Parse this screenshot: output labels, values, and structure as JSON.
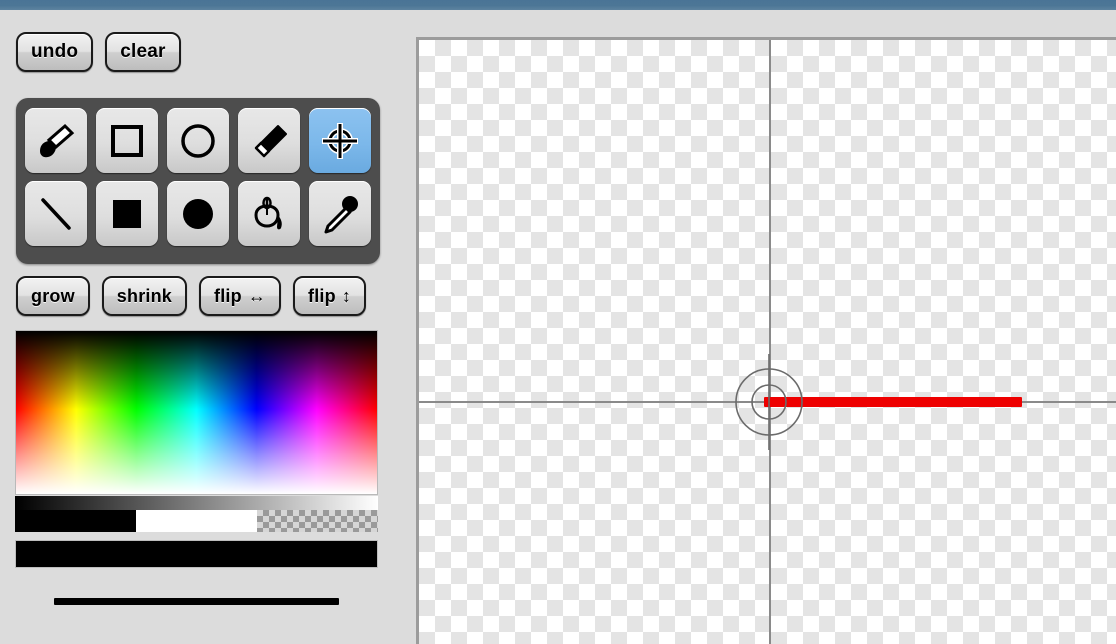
{
  "app": {
    "title": "Paint Canvas Editor",
    "accent_color": "#4a7496",
    "panel_background": "#dcdcdc",
    "palette_background": "#4d4d4d"
  },
  "history_buttons": [
    {
      "label": "undo",
      "name": "undo-button"
    },
    {
      "label": "clear",
      "name": "clear-button"
    }
  ],
  "tools": {
    "selected": "move-target",
    "selected_color": "#7cb8ea",
    "row1": [
      {
        "label": "brush",
        "icon": "brush-icon",
        "selected": false
      },
      {
        "label": "rectangle outline",
        "icon": "square-outline-icon",
        "selected": false
      },
      {
        "label": "ellipse outline",
        "icon": "circle-outline-icon",
        "selected": false
      },
      {
        "label": "eraser",
        "icon": "eraser-icon",
        "selected": false
      },
      {
        "label": "move target",
        "icon": "crosshair-target-icon",
        "selected": true
      }
    ],
    "row2": [
      {
        "label": "line",
        "icon": "line-icon",
        "selected": false
      },
      {
        "label": "filled rectangle",
        "icon": "square-filled-icon",
        "selected": false
      },
      {
        "label": "filled ellipse",
        "icon": "circle-filled-icon",
        "selected": false
      },
      {
        "label": "paint bucket",
        "icon": "paint-bucket-icon",
        "selected": false
      },
      {
        "label": "eyedropper",
        "icon": "eyedropper-icon",
        "selected": false
      }
    ]
  },
  "transform_buttons": [
    {
      "label": "grow",
      "arrow": "",
      "name": "grow-button"
    },
    {
      "label": "shrink",
      "arrow": "",
      "name": "shrink-button"
    },
    {
      "label": "flip",
      "arrow": "↔",
      "name": "flip-horizontal-button"
    },
    {
      "label": "flip",
      "arrow": "↕",
      "name": "flip-vertical-button"
    }
  ],
  "color_picker": {
    "hue_stops": [
      "#ff0000",
      "#ffff00",
      "#00ff00",
      "#00ffff",
      "#0000ff",
      "#ff00ff",
      "#ff0000"
    ],
    "gray_ramp_from": "#000000",
    "gray_ramp_to": "#ffffff",
    "swatches": [
      {
        "label": "black",
        "color": "#000000"
      },
      {
        "label": "white",
        "color": "#ffffff"
      },
      {
        "label": "transparent",
        "color": "transparent"
      }
    ],
    "current_color": "#000000"
  },
  "stroke_preview": {
    "color": "#000000",
    "thickness_px": 7
  },
  "canvas": {
    "guide_color": "#8a8a8a",
    "checker_light": "#ffffff",
    "checker_dark": "#e4e4e4",
    "strokes": [
      {
        "type": "line",
        "color": "#ee0000",
        "thickness_px": 10
      }
    ],
    "cursor": {
      "icon": "crosshair-target-cursor",
      "color": "#6b6b6b"
    }
  }
}
